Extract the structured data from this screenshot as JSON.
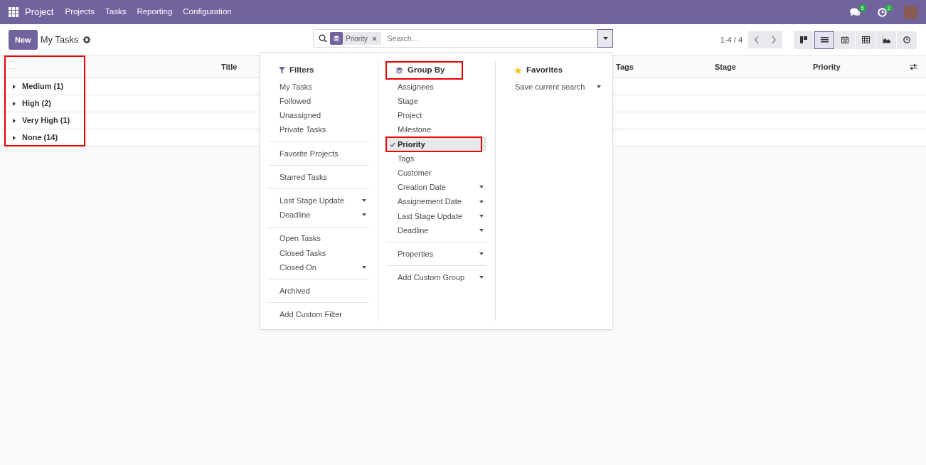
{
  "navbar": {
    "app": "Project",
    "menu": [
      "Projects",
      "Tasks",
      "Reporting",
      "Configuration"
    ],
    "messages_badge": "5",
    "activities_badge": "2"
  },
  "control_panel": {
    "new_button": "New",
    "breadcrumb": "My Tasks",
    "search": {
      "facet": "Priority",
      "placeholder": "Search..."
    },
    "pager": "1-4 / 4",
    "views": [
      {
        "kind": "kanban",
        "selected": false
      },
      {
        "kind": "list",
        "selected": true
      },
      {
        "kind": "calendar",
        "selected": false
      },
      {
        "kind": "pivot",
        "selected": false
      },
      {
        "kind": "graph",
        "selected": false
      },
      {
        "kind": "activity",
        "selected": false
      }
    ]
  },
  "table": {
    "select_all_checked": false,
    "columns": [
      "Title",
      "Tags",
      "Stage",
      "Priority"
    ],
    "annotated": true,
    "groups": [
      {
        "label": "Medium (1)",
        "expanded": false
      },
      {
        "label": "High (2)",
        "expanded": false
      },
      {
        "label": "Very High (1)",
        "expanded": false
      },
      {
        "label": "None (14)",
        "expanded": false
      }
    ]
  },
  "search_panel": {
    "filters": {
      "title": "Filters",
      "sections": [
        [
          {
            "label": "My Tasks",
            "submenu": false,
            "selected": false
          },
          {
            "label": "Followed",
            "submenu": false,
            "selected": false
          },
          {
            "label": "Unassigned",
            "submenu": false,
            "selected": false
          },
          {
            "label": "Private Tasks",
            "submenu": false,
            "selected": false
          }
        ],
        [
          {
            "label": "Favorite Projects",
            "submenu": false,
            "selected": false
          }
        ],
        [
          {
            "label": "Starred Tasks",
            "submenu": false,
            "selected": false
          }
        ],
        [
          {
            "label": "Last Stage Update",
            "submenu": true,
            "selected": false
          },
          {
            "label": "Deadline",
            "submenu": true,
            "selected": false
          }
        ],
        [
          {
            "label": "Open Tasks",
            "submenu": false,
            "selected": false
          },
          {
            "label": "Closed Tasks",
            "submenu": false,
            "selected": false
          },
          {
            "label": "Closed On",
            "submenu": true,
            "selected": false
          }
        ],
        [
          {
            "label": "Archived",
            "submenu": false,
            "selected": false
          }
        ],
        [
          {
            "label": "Add Custom Filter",
            "submenu": false,
            "selected": false
          }
        ]
      ]
    },
    "group_by": {
      "title": "Group By",
      "annotated": true,
      "sections": [
        [
          {
            "label": "Assignees",
            "submenu": false,
            "selected": false,
            "annotated": false
          },
          {
            "label": "Stage",
            "submenu": false,
            "selected": false,
            "annotated": false
          },
          {
            "label": "Project",
            "submenu": false,
            "selected": false,
            "annotated": false
          },
          {
            "label": "Milestone",
            "submenu": false,
            "selected": false,
            "annotated": false
          },
          {
            "label": "Priority",
            "submenu": false,
            "selected": true,
            "annotated": true
          },
          {
            "label": "Tags",
            "submenu": false,
            "selected": false,
            "annotated": false
          },
          {
            "label": "Customer",
            "submenu": false,
            "selected": false,
            "annotated": false
          },
          {
            "label": "Creation Date",
            "submenu": true,
            "selected": false,
            "annotated": false
          },
          {
            "label": "Assignement Date",
            "submenu": true,
            "selected": false,
            "annotated": false
          },
          {
            "label": "Last Stage Update",
            "submenu": true,
            "selected": false,
            "annotated": false
          },
          {
            "label": "Deadline",
            "submenu": true,
            "selected": false,
            "annotated": false
          }
        ],
        [
          {
            "label": "Properties",
            "submenu": true,
            "selected": false,
            "annotated": false
          }
        ],
        [
          {
            "label": "Add Custom Group",
            "submenu": true,
            "selected": false,
            "annotated": false
          }
        ]
      ]
    },
    "favorites": {
      "title": "Favorites",
      "items": [
        {
          "label": "Save current search",
          "submenu": true
        }
      ]
    }
  }
}
